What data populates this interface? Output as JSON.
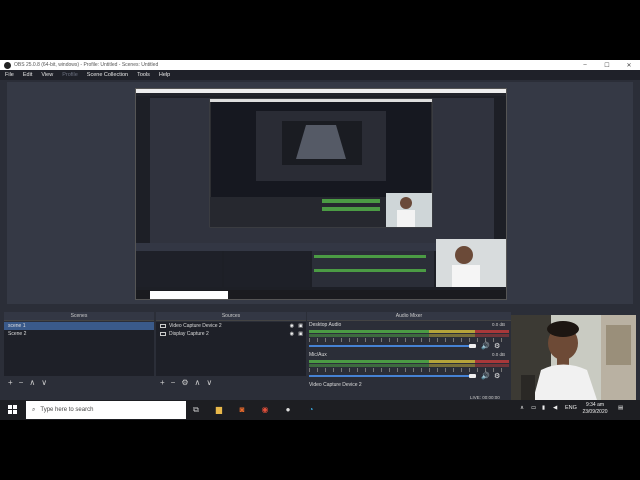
{
  "titlebar": {
    "title": "OBS 25.0.8 (64-bit, windows) - Profile: Untitled - Scenes: Untitled",
    "minimize": "–",
    "maximize": "☐",
    "close": "✕"
  },
  "menu": [
    "File",
    "Edit",
    "View",
    "Profile",
    "Scene Collection",
    "Tools",
    "Help"
  ],
  "panels": {
    "scenes": {
      "header": "Scenes",
      "items": [
        "scene 1",
        "Scene 2"
      ],
      "selected": 0
    },
    "sources": {
      "header": "Sources",
      "items": [
        {
          "label": "Video Capture Device 2",
          "icon": "monitor-icon"
        },
        {
          "label": "Display Capture 2",
          "icon": "monitor-icon"
        }
      ]
    },
    "mixer": {
      "header": "Audio Mixer",
      "channels": [
        {
          "label": "Desktop Audio",
          "db": "0.0 dB"
        },
        {
          "label": "Mic/Aux",
          "db": "0.0 dB"
        },
        {
          "label": "Video Capture Device 2",
          "db": ""
        }
      ]
    }
  },
  "toolbar_icons": {
    "add": "+",
    "remove": "−",
    "settings": "⚙",
    "up": "∧",
    "down": "∨"
  },
  "status": {
    "live": "LIVE: 00:00:00"
  },
  "taskbar": {
    "search_placeholder": "Type here to search",
    "lang": "ENG",
    "time": "9:34 am",
    "date": "23/09/2020"
  },
  "colors": {
    "bg": "#2b2e38",
    "panel": "#1e2028",
    "selected": "#3a5a8a",
    "meter_green": "#4b9b44",
    "meter_yellow": "#b5a33a",
    "meter_red": "#a8383a",
    "slider": "#4682d4"
  }
}
